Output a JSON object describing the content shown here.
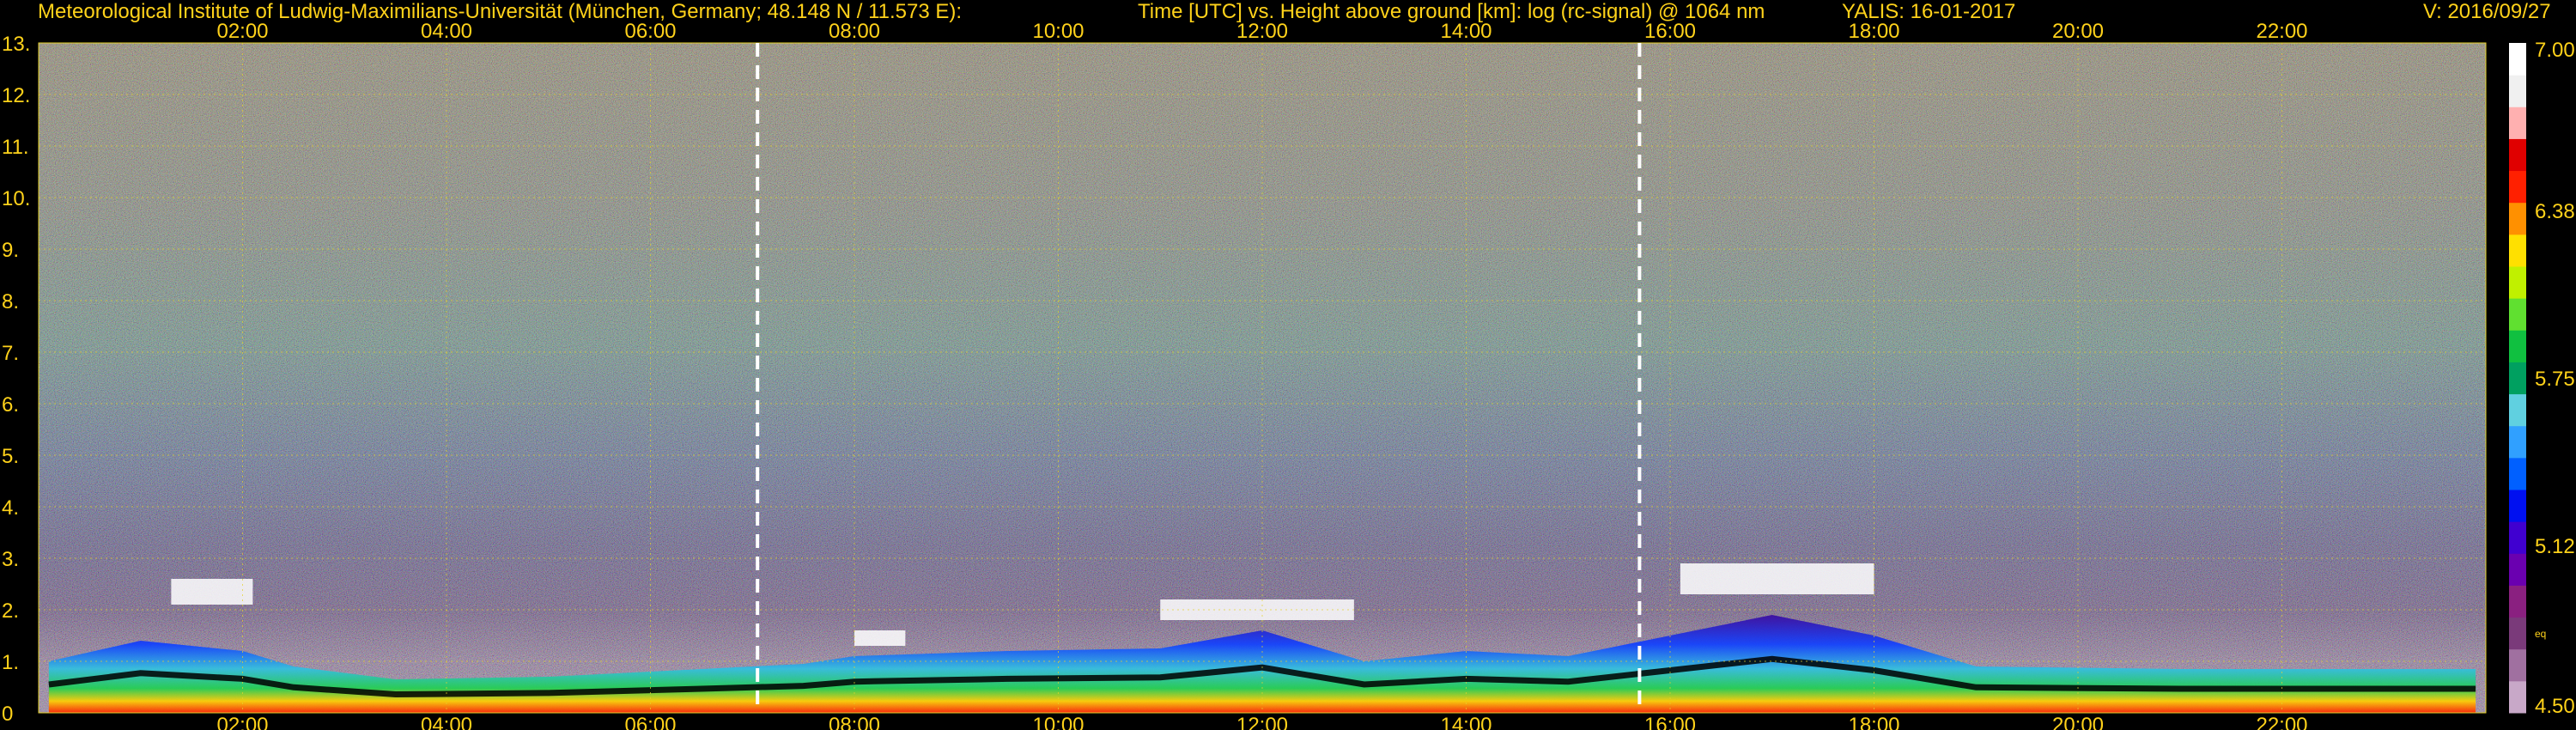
{
  "header": {
    "institute": "Meteorological Institute of Ludwig-Maximilians-Universität (München, Germany; 48.148 N / 11.573 E):",
    "axes_title": "Time [UTC] vs. Height above ground [km]: log (rc-signal) @ 1064 nm",
    "station_date": "YALIS: 16-01-2017",
    "version": "V: 2016/09/27"
  },
  "chart_data": {
    "type": "heatmap",
    "title": "Time [UTC] vs. Height above ground [km]: log (rc-signal) @ 1064 nm",
    "xlabel": "Time [UTC]",
    "ylabel": "Height above ground [km]",
    "xlim_hours": [
      0,
      24
    ],
    "ylim_km": [
      0,
      13
    ],
    "x_ticks": [
      "02:00",
      "04:00",
      "06:00",
      "08:00",
      "10:00",
      "12:00",
      "14:00",
      "16:00",
      "18:00",
      "20:00",
      "22:00"
    ],
    "y_ticks": [
      "0",
      "1.",
      "2.",
      "3.",
      "4.",
      "5.",
      "6.",
      "7.",
      "8.",
      "9.",
      "10.",
      "11.",
      "12.",
      "13."
    ],
    "grid": true,
    "markers_utc_hours": [
      7.05,
      15.7
    ],
    "boundary_layer": [
      {
        "time": 0.1,
        "top_km": 1.0
      },
      {
        "time": 1.0,
        "top_km": 1.4
      },
      {
        "time": 2.0,
        "top_km": 1.2
      },
      {
        "time": 2.5,
        "top_km": 0.9
      },
      {
        "time": 3.5,
        "top_km": 0.65
      },
      {
        "time": 5.0,
        "top_km": 0.7
      },
      {
        "time": 6.5,
        "top_km": 0.85
      },
      {
        "time": 7.5,
        "top_km": 0.95
      },
      {
        "time": 8.0,
        "top_km": 1.1
      },
      {
        "time": 9.5,
        "top_km": 1.2
      },
      {
        "time": 11.0,
        "top_km": 1.25
      },
      {
        "time": 12.0,
        "top_km": 1.6
      },
      {
        "time": 13.0,
        "top_km": 1.0
      },
      {
        "time": 14.0,
        "top_km": 1.2
      },
      {
        "time": 15.0,
        "top_km": 1.1
      },
      {
        "time": 16.0,
        "top_km": 1.5
      },
      {
        "time": 17.0,
        "top_km": 1.9
      },
      {
        "time": 18.0,
        "top_km": 1.5
      },
      {
        "time": 19.0,
        "top_km": 0.9
      },
      {
        "time": 21.0,
        "top_km": 0.85
      },
      {
        "time": 23.9,
        "top_km": 0.85
      }
    ],
    "cloud_layers": [
      {
        "t0": 1.3,
        "t1": 2.1,
        "base_km": 2.1,
        "top_km": 2.6
      },
      {
        "t0": 8.0,
        "t1": 8.5,
        "base_km": 1.3,
        "top_km": 1.6
      },
      {
        "t0": 11.0,
        "t1": 12.9,
        "base_km": 1.8,
        "top_km": 2.2
      },
      {
        "t0": 16.1,
        "t1": 18.0,
        "base_km": 2.3,
        "top_km": 2.9
      }
    ],
    "colorbar": {
      "min": 4.5,
      "max": 7.0,
      "labels": [
        "7.00",
        "6.38",
        "5.75",
        "5.12",
        "4.50"
      ],
      "unit_note": "eq",
      "colors": [
        "#c8a8c8",
        "#a070a0",
        "#7a3a7a",
        "#8a2080",
        "#6a00b0",
        "#4000d0",
        "#0010f0",
        "#0060ff",
        "#30a0ff",
        "#60d0e0",
        "#00a060",
        "#10c040",
        "#60e030",
        "#c0f000",
        "#ffe000",
        "#ff9000",
        "#ff2000",
        "#e00000",
        "#ffb0b0",
        "#f0f0f0",
        "#ffffff"
      ]
    }
  }
}
